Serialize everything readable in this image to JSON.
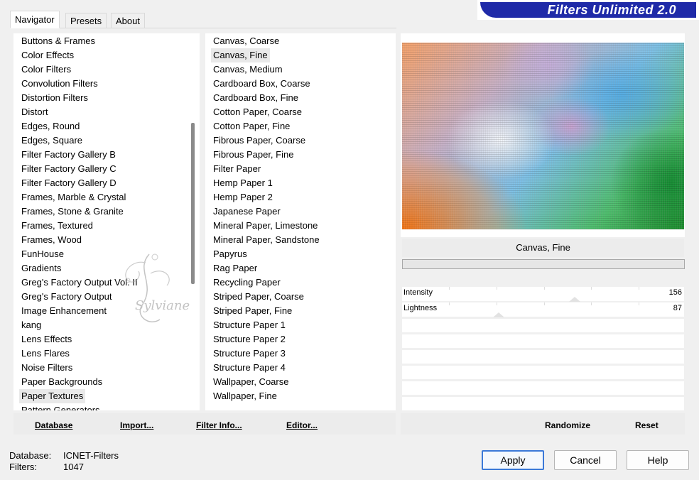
{
  "banner": {
    "title": "Filters Unlimited 2.0"
  },
  "tabs": [
    {
      "label": "Navigator",
      "active": true
    },
    {
      "label": "Presets",
      "active": false
    },
    {
      "label": "About",
      "active": false
    }
  ],
  "categories": {
    "items": [
      "Buttons & Frames",
      "Color Effects",
      "Color Filters",
      "Convolution Filters",
      "Distortion Filters",
      "Distort",
      "Edges, Round",
      "Edges, Square",
      "Filter Factory Gallery B",
      "Filter Factory Gallery C",
      "Filter Factory Gallery D",
      "Frames, Marble & Crystal",
      "Frames, Stone & Granite",
      "Frames, Textured",
      "Frames, Wood",
      "FunHouse",
      "Gradients",
      "Greg's Factory Output Vol. II",
      "Greg's Factory Output",
      "Image Enhancement",
      "kang",
      "Lens Effects",
      "Lens Flares",
      "Noise Filters",
      "Paper Backgrounds",
      "Paper Textures",
      "Pattern Generators"
    ],
    "selected": "Paper Textures"
  },
  "filters": {
    "items": [
      "Canvas, Coarse",
      "Canvas, Fine",
      "Canvas, Medium",
      "Cardboard Box, Coarse",
      "Cardboard Box, Fine",
      "Cotton Paper, Coarse",
      "Cotton Paper, Fine",
      "Fibrous Paper, Coarse",
      "Fibrous Paper, Fine",
      "Filter Paper",
      "Hemp Paper 1",
      "Hemp Paper 2",
      "Japanese Paper",
      "Mineral Paper, Limestone",
      "Mineral Paper, Sandstone",
      "Papyrus",
      "Rag Paper",
      "Recycling Paper",
      "Striped Paper, Coarse",
      "Striped Paper, Fine",
      "Structure Paper 1",
      "Structure Paper 2",
      "Structure Paper 3",
      "Structure Paper 4",
      "Wallpaper, Coarse",
      "Wallpaper, Fine"
    ],
    "selected": "Canvas, Fine"
  },
  "left_buttons": {
    "database": "Database",
    "import": "Import...",
    "filter_info": "Filter Info...",
    "editor": "Editor..."
  },
  "preview": {
    "filter_name": "Canvas, Fine"
  },
  "sliders": [
    {
      "label": "Intensity",
      "value": "156"
    },
    {
      "label": "Lightness",
      "value": "87"
    }
  ],
  "right_buttons": {
    "randomize": "Randomize",
    "reset": "Reset"
  },
  "status": {
    "database_label": "Database:",
    "database_value": "ICNET-Filters",
    "filters_label": "Filters:",
    "filters_value": "1047"
  },
  "dialog_buttons": {
    "apply": "Apply",
    "cancel": "Cancel",
    "help": "Help"
  },
  "watermark": {
    "text": "Sylviane"
  },
  "colors": {
    "banner_blue": "#1f2aa8",
    "accent_border": "#3b79d8"
  }
}
